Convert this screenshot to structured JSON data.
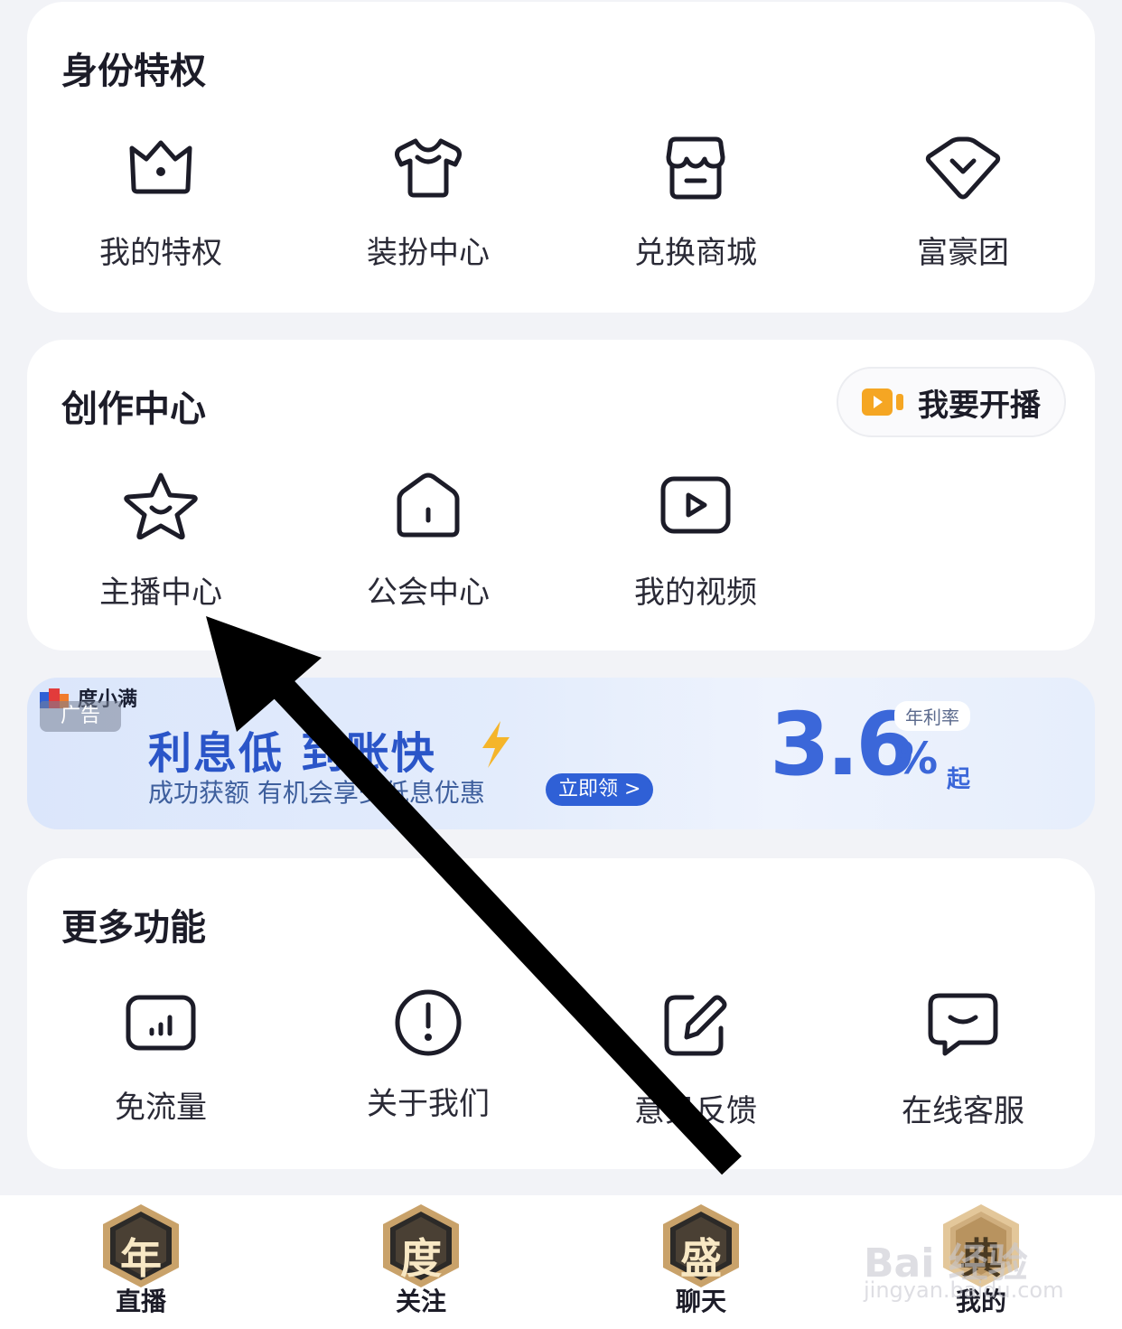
{
  "privileges": {
    "title": "身份特权",
    "items": [
      {
        "label": "我的特权",
        "icon": "crown-icon"
      },
      {
        "label": "装扮中心",
        "icon": "tshirt-icon"
      },
      {
        "label": "兑换商城",
        "icon": "shop-icon"
      },
      {
        "label": "富豪团",
        "icon": "diamond-icon"
      }
    ]
  },
  "creation": {
    "title": "创作中心",
    "live_button": "我要开播",
    "items": [
      {
        "label": "主播中心",
        "icon": "star-icon"
      },
      {
        "label": "公会中心",
        "icon": "house-icon"
      },
      {
        "label": "我的视频",
        "icon": "video-icon"
      }
    ]
  },
  "ad": {
    "brand": "度小满",
    "tag": "广告",
    "headline": "利息低 到账快",
    "subtitle": "成功获额 有机会享受低息优惠",
    "cta": "立即领 >",
    "rate_label": "年利率",
    "rate_value": "3.6",
    "rate_unit": "%",
    "rate_suffix": "起"
  },
  "more": {
    "title": "更多功能",
    "items": [
      {
        "label": "免流量",
        "icon": "data-traffic-icon"
      },
      {
        "label": "关于我们",
        "icon": "info-exclamation-icon"
      },
      {
        "label": "意见反馈",
        "icon": "edit-feedback-icon"
      },
      {
        "label": "在线客服",
        "icon": "chat-bubble-icon"
      }
    ]
  },
  "tabbar": {
    "tabs": [
      {
        "badge": "年",
        "label": "直播"
      },
      {
        "badge": "度",
        "label": "关注"
      },
      {
        "badge": "盛",
        "label": "聊天"
      },
      {
        "badge": "典",
        "label": "我的"
      }
    ]
  },
  "watermark": {
    "text": "Bai 经验",
    "sub": "jingyan.baidu.com"
  },
  "colors": {
    "background": "#f2f3f7",
    "card": "#ffffff",
    "icon_stroke": "#1c1c28",
    "ad_blue": "#2a55c8",
    "live_orange": "#f5a623"
  }
}
